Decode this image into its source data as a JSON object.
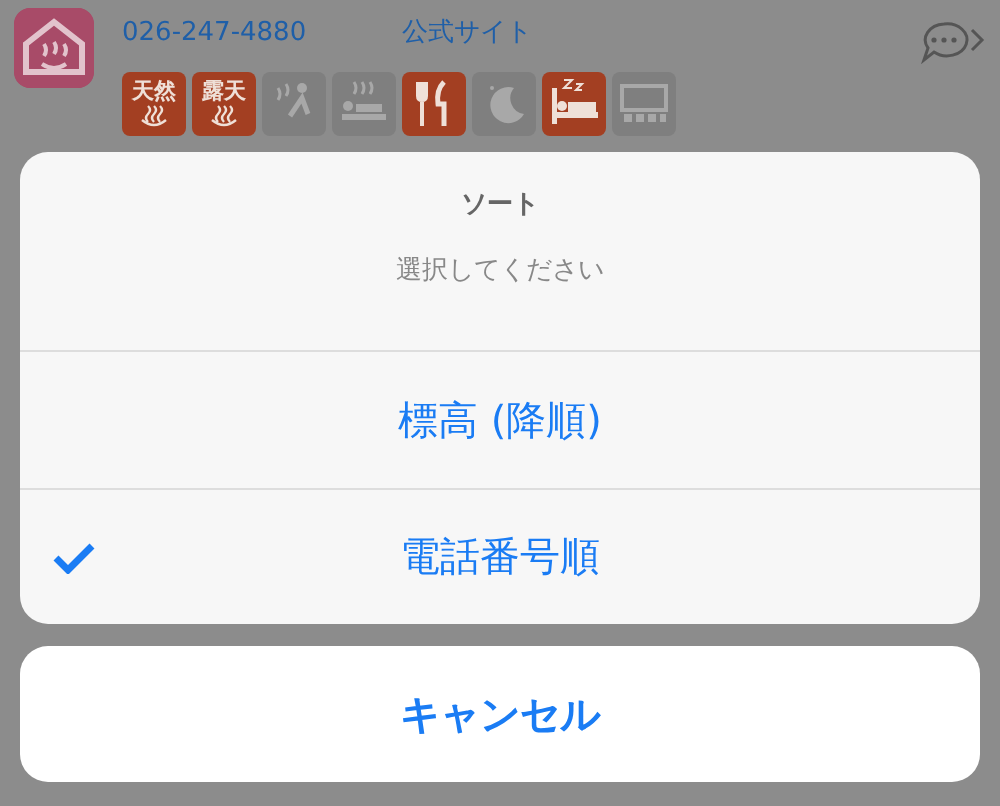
{
  "header": {
    "phone": "026-247-4880",
    "site_link": "公式サイト"
  },
  "amenities": [
    {
      "kind": "natural",
      "label": "天然",
      "active": true
    },
    {
      "kind": "outdoor",
      "label": "露天",
      "active": true
    },
    {
      "kind": "sauna",
      "active": false
    },
    {
      "kind": "rest",
      "active": false
    },
    {
      "kind": "meal",
      "active": true
    },
    {
      "kind": "night",
      "active": false
    },
    {
      "kind": "stay",
      "active": true
    },
    {
      "kind": "hall",
      "active": false
    }
  ],
  "action_sheet": {
    "title": "ソート",
    "message": "選択してください",
    "options": [
      {
        "label": "標高 (降順)",
        "selected": false
      },
      {
        "label": "電話番号順",
        "selected": true
      }
    ],
    "cancel": "キャンセル"
  }
}
